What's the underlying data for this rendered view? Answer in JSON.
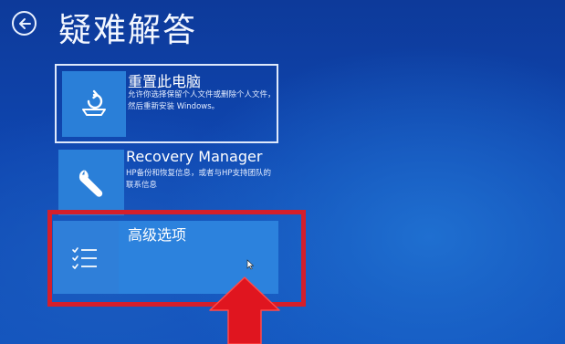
{
  "header": {
    "title": "疑难解答",
    "back_icon": "back-arrow-icon"
  },
  "options": [
    {
      "id": "reset",
      "title": "重置此电脑",
      "description": "允许你选择保留个人文件或删除个人文件，然后重新安装 Windows。",
      "icon": "reset-pc-icon",
      "selected": true
    },
    {
      "id": "recovery",
      "title": "Recovery Manager",
      "description": "HP备份和恢复信息，或者与HP支持团队的联系信息",
      "icon": "wrench-icon"
    },
    {
      "id": "advanced",
      "title": "高级选项",
      "description": "",
      "icon": "checklist-icon",
      "hovered": true
    }
  ],
  "annotation": {
    "highlight_color": "#d41f2b",
    "arrow_color": "#e0151f"
  },
  "colors": {
    "background": "#0f46b0",
    "tile": "#2a7fd8",
    "text": "#ffffff"
  }
}
